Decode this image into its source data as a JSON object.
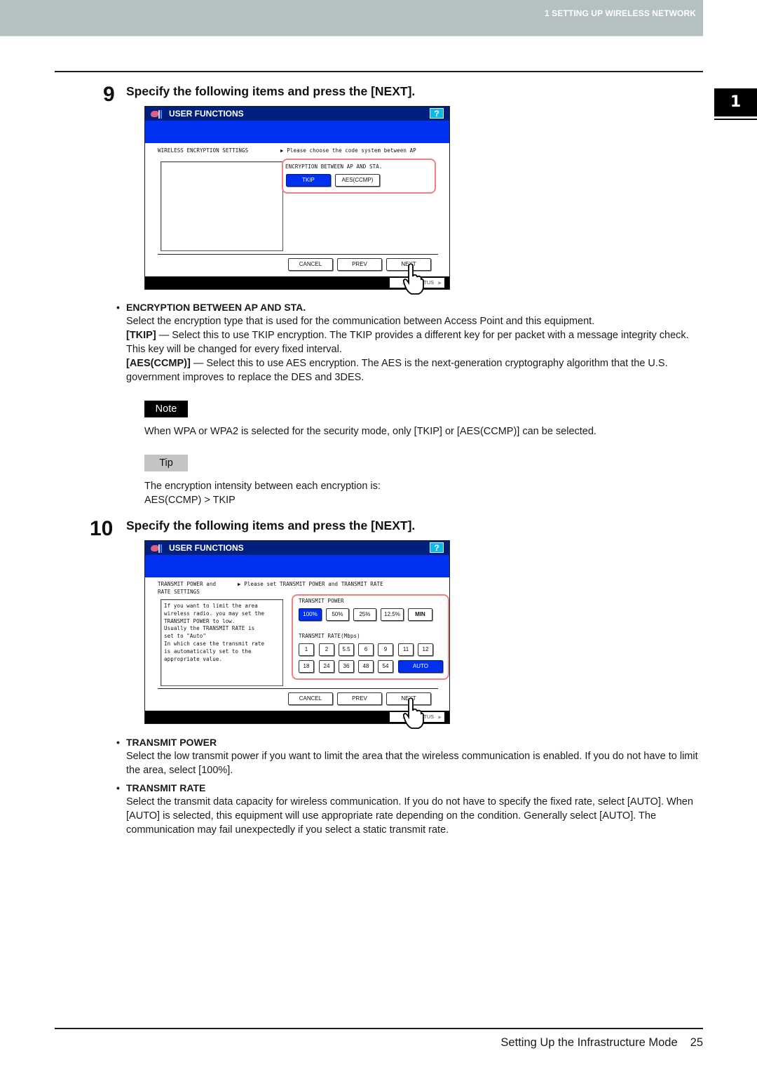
{
  "header": {
    "chapter_label": "1 SETTING UP WIRELESS NETWORK"
  },
  "chapter_tab": "1",
  "steps": [
    {
      "number": "9",
      "title": "Specify the following items and press the [NEXT].",
      "panel": {
        "title": "USER FUNCTIONS",
        "help": "?",
        "left_label": "WIRELESS ENCRYPTION SETTINGS",
        "right_label": "▶ Please choose the code system between AP",
        "group_label": "ENCRYPTION BETWEEN AP AND STA.",
        "options": [
          {
            "label": "TKIP",
            "selected": true
          },
          {
            "label": "AES(CCMP)",
            "selected": false
          }
        ],
        "buttons": {
          "cancel": "CANCEL",
          "prev": "PREV",
          "next": "NEXT"
        },
        "job_status": "JOB STATUS"
      },
      "sections": [
        {
          "heading": "ENCRYPTION BETWEEN AP AND STA.",
          "intro": "Select the encryption type that is used for the communication between Access Point and this equipment.",
          "items": [
            {
              "term": "[TKIP]",
              "text": " — Select this to use TKIP encryption.  The TKIP provides a different key for per packet with a message integrity check.  This key will be changed for every fixed interval."
            },
            {
              "term": "[AES(CCMP)]",
              "text": " — Select this to use AES encryption. The AES is the next-generation cryptography algorithm that the U.S. government improves to replace the DES and 3DES."
            }
          ]
        }
      ],
      "note": {
        "tag": "Note",
        "text": "When WPA or WPA2 is selected for the security mode, only [TKIP] or [AES(CCMP)] can be selected."
      },
      "tip": {
        "tag": "Tip",
        "line1": "The encryption intensity between each encryption is:",
        "line2": "AES(CCMP) > TKIP"
      }
    },
    {
      "number": "10",
      "title": "Specify the following items and press the [NEXT].",
      "panel": {
        "title": "USER FUNCTIONS",
        "help": "?",
        "left_label_line1": "TRANSMIT POWER and",
        "left_label_line2": "RATE SETTINGS",
        "right_label": "▶ Please set TRANSMIT POWER and TRANSMIT RATE",
        "info_lines": [
          "If you want to limit the area",
          "wireless radio. you may set the",
          "TRANSMIT POWER to low.",
          "Usually the TRANSMIT RATE is",
          "set to \"Auto\"",
          "In which case the transmit rate",
          "is automatically set to the",
          "appropriate value."
        ],
        "power_label": "TRANSMIT POWER",
        "power_options": [
          {
            "label": "100%",
            "selected": true
          },
          {
            "label": "50%",
            "selected": false
          },
          {
            "label": "25%",
            "selected": false
          },
          {
            "label": "12.5%",
            "selected": false
          },
          {
            "label": "MIN",
            "selected": false
          }
        ],
        "rate_label": "TRANSMIT RATE(Mbps)",
        "rate_row1": [
          "1",
          "2",
          "5.5",
          "6",
          "9",
          "11",
          "12"
        ],
        "rate_row2": [
          "18",
          "24",
          "36",
          "48",
          "54"
        ],
        "rate_auto": {
          "label": "AUTO",
          "selected": true
        },
        "buttons": {
          "cancel": "CANCEL",
          "prev": "PREV",
          "next": "NEXT"
        },
        "job_status": "JOB STATUS"
      },
      "sections": [
        {
          "heading": "TRANSMIT POWER",
          "text": "Select the low transmit power if you want to limit the area that the wireless communication is enabled.  If you do not have to limit the area, select [100%]."
        },
        {
          "heading": "TRANSMIT RATE",
          "text": "Select the transmit data capacity for wireless communication.  If you do not have to specify the fixed rate, select [AUTO].  When [AUTO] is selected, this equipment will use appropriate rate depending on the condition.  Generally select [AUTO].  The communication may fail unexpectedly if you select a static transmit rate."
        }
      ]
    }
  ],
  "bullet_glyph": "•",
  "footer": {
    "title": "Setting Up the Infrastructure Mode",
    "page": "25"
  }
}
